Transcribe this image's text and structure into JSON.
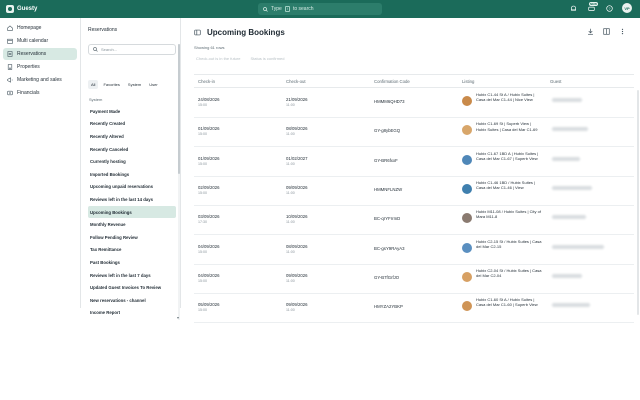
{
  "app": {
    "name": "Guesty"
  },
  "topbar": {
    "search_placeholder": "Type",
    "search_key": "/",
    "search_suffix": "to search",
    "new_badge": "NEW",
    "avatar_initials": "VP"
  },
  "nav": {
    "items": [
      {
        "label": "Homepage",
        "icon": "home-icon"
      },
      {
        "label": "Multi calendar",
        "icon": "calendar-icon"
      },
      {
        "label": "Reservations",
        "icon": "reservations-icon",
        "active": true
      },
      {
        "label": "Properties",
        "icon": "properties-icon"
      },
      {
        "label": "Marketing and sales",
        "icon": "megaphone-icon"
      },
      {
        "label": "Financials",
        "icon": "financials-icon"
      }
    ]
  },
  "subnav": {
    "title": "Reservations",
    "search_placeholder": "Search...",
    "tabs": [
      "All",
      "Favorites",
      "System",
      "User"
    ],
    "group_title": "System",
    "items": [
      "Payment Made",
      "Recently Created",
      "Recently Altered",
      "Recently Canceled",
      "Currently hosting",
      "Imported Bookings",
      "Upcoming unpaid reservations",
      "Reviews left in the last 14 days",
      "Upcoming Bookings",
      "Monthly Revenue",
      "Follow Pending Review",
      "Tax Remittance",
      "Past Bookings",
      "Reviews left in the last 7 days",
      "Updated Guest Invoices To Review",
      "New reservations - channel",
      "Income Report"
    ],
    "active_index": 8
  },
  "main": {
    "title": "Upcoming Bookings",
    "showing": "Showing 61 rows",
    "filters": [
      "Check-out is in the future",
      "Status is confirmed"
    ],
    "columns": [
      "Check-in",
      "Check-out",
      "Confirmation Code",
      "Listing",
      "Guest"
    ],
    "rows": [
      {
        "checkin": "24/08/2026",
        "checkin_time": "15:00",
        "checkout": "21/09/2026",
        "checkout_time": "11:00",
        "code": "HMMM6QHD73",
        "listing": "Hubix C1-44 St A / Hubix Suites | Casa del Mar C1-44 | Nice View",
        "thumb": "#c98a4a"
      },
      {
        "checkin": "01/09/2026",
        "checkin_time": "15:00",
        "checkout": "08/09/2026",
        "checkout_time": "11:00",
        "code": "GY-g8ybEGQ",
        "listing": "Hubix C1-69 St | Superb View | Hubix Suites | Casa del Mar C1-69",
        "thumb": "#d8a66a"
      },
      {
        "checkin": "01/09/2026",
        "checkin_time": "15:00",
        "checkout": "01/02/2027",
        "checkout_time": "11:00",
        "code": "GY-BR6fxxF",
        "listing": "Hubix C1-67 1BD A | Hubix Suites | Casa del Mar C1-67 | Superb View",
        "thumb": "#4f87b8"
      },
      {
        "checkin": "02/09/2026",
        "checkin_time": "15:00",
        "checkout": "09/09/2026",
        "checkout_time": "11:00",
        "code": "HMMNFLNZW",
        "listing": "Hubix C1-46 1BD / Hubix Suites | Casa del Mar C1-46 | View",
        "thumb": "#3f7fae"
      },
      {
        "checkin": "03/09/2026",
        "checkin_time": "17:30",
        "checkout": "10/09/2026",
        "checkout_time": "11:00",
        "code": "BC-qrYFrrmD",
        "listing": "Hubix M11-08 / Hubix Suites | City of Mara M11-8",
        "thumb": "#8a7a70"
      },
      {
        "checkin": "04/09/2026",
        "checkin_time": "15:00",
        "checkout": "08/09/2026",
        "checkout_time": "11:00",
        "code": "BC-gsY9RAyA3",
        "listing": "Hubix C2-15 St / Hubix Suites | Casa del Mar C2-15",
        "thumb": "#5a8fc0"
      },
      {
        "checkin": "04/09/2026",
        "checkin_time": "15:00",
        "checkout": "09/09/2026",
        "checkout_time": "11:00",
        "code": "GY-B7fGrfJO",
        "listing": "Hubix C2-04 St / Hubix Suites | Casa del Mar C2-04",
        "thumb": "#d7a063"
      },
      {
        "checkin": "05/09/2026",
        "checkin_time": "15:00",
        "checkout": "09/09/2026",
        "checkout_time": "11:00",
        "code": "HMYZA2YBKP",
        "listing": "Hubix C1-60 St A / Hubix Suites | Casa del Mar C1-60 | Superb View",
        "thumb": "#cf9456"
      }
    ]
  }
}
